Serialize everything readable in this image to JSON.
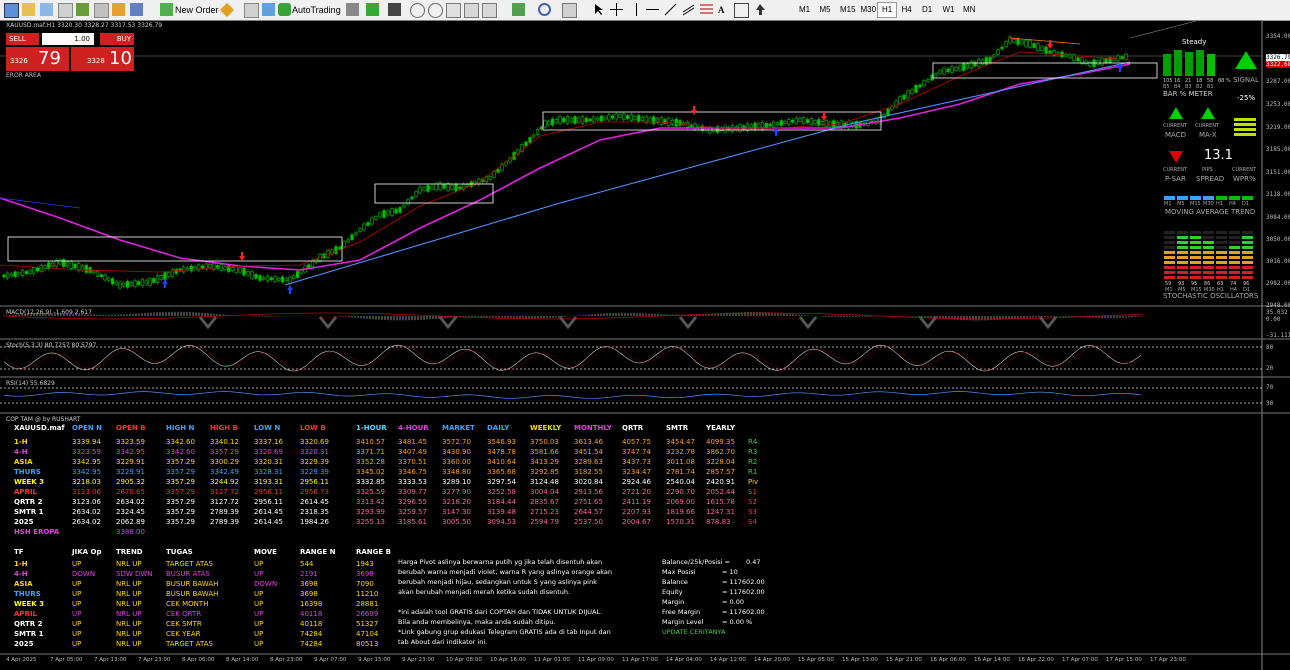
{
  "toolbar": {
    "new_order": "New Order",
    "autotrading": "AutoTrading",
    "timeframes": [
      "M1",
      "M5",
      "M15",
      "M30",
      "H1",
      "H4",
      "D1",
      "W1",
      "MN"
    ],
    "active_tf": "H1"
  },
  "chart": {
    "symbol_info": "XAUUSD.maf,H1  3320.30 3328.27 3317.53 3326.79",
    "zone_label": "EROR AREA",
    "one_click": {
      "sell_label": "SELL",
      "buy_label": "BUY",
      "lot": "1.00",
      "sell_big": "79",
      "sell_small": "3326",
      "buy_big": "10",
      "buy_small": "3328"
    },
    "price_scale": [
      "3354.00",
      "3326.79",
      "3322.68",
      "3287.00",
      "3253.00",
      "3219.00",
      "3185.00",
      "3151.00",
      "3118.00",
      "3084.00",
      "3050.00",
      "3016.00",
      "2982.00",
      "2948.00"
    ],
    "time_axis": [
      "4 Apr 2025",
      "7 Apr 05:00",
      "7 Apr 13:00",
      "7 Apr 23:00",
      "8 Apr 06:00",
      "8 Apr 14:00",
      "8 Apr 23:00",
      "9 Apr 07:00",
      "9 Apr 15:00",
      "9 Apr 23:00",
      "10 Apr 08:00",
      "10 Apr 16:00",
      "11 Apr 01:00",
      "11 Apr 09:00",
      "11 Apr 17:00",
      "14 Apr 04:00",
      "14 Apr 12:00",
      "14 Apr 20:00",
      "15 Apr 05:00",
      "15 Apr 13:00",
      "15 Apr 21:00",
      "16 Apr 06:00",
      "16 Apr 14:00",
      "16 Apr 22:00",
      "17 Apr 07:00",
      "17 Apr 15:00",
      "17 Apr 23:00"
    ],
    "colors": {
      "bull": "#00c000",
      "bear": "#00c000",
      "ma_fast": "#c00000",
      "ma_slow": "#e020e0",
      "trend": "#5090ff",
      "bg": "#000000"
    }
  },
  "indicators": {
    "macd_label": "MACD(12,26,9) -1.609 2.617",
    "macd_scale": [
      "35.032",
      "0.00",
      "-31.111"
    ],
    "stoch_label": "Stoch(5,3,3) 80.7257 80.5797",
    "stoch_scale": [
      "80",
      "20"
    ],
    "rsi_label": "RSI(14) 55.6829",
    "rsi_scale": [
      "70",
      "30"
    ],
    "cop_label": "COP TAM @ by RUSHART"
  },
  "dashboard": {
    "steady": "Steady",
    "bar_meter_values": [
      "105",
      "16",
      "21",
      "18",
      "58",
      "88 %"
    ],
    "bar_meter_tfs": [
      "B5",
      "B4",
      "B3",
      "B2",
      "B1"
    ],
    "bar_meter_label": "BAR % METER",
    "signal_label": "SIGNAL",
    "signal_pct": "-25%",
    "macd": "MACD",
    "max": "MA-X",
    "current": "CURRENT",
    "psar": "P-SAR",
    "spread": "SPREAD",
    "spread_value": "13.1",
    "pips": "PIPS",
    "wpr": "WPR%",
    "ma_trend_tfs": [
      "M1",
      "M5",
      "M15",
      "M30",
      "H1",
      "H4",
      "D1"
    ],
    "ma_trend_label": "MOVING AVERAGE TREND",
    "stoch_values": [
      "59",
      "93",
      "95",
      "86",
      "63",
      "74",
      "96"
    ],
    "stoch_tfs": [
      "M1",
      "M5",
      "M15",
      "M30",
      "H1",
      "H4",
      "D1"
    ],
    "stoch_label": "STOCHASTIC OSCILLATORS"
  },
  "table1": {
    "headers": [
      "XAUUSD.maf",
      "OPEN N",
      "OPEN B",
      "HIGH N",
      "HIGH B",
      "LOW N",
      "LOW B",
      "1-HOUR",
      "4-HOUR",
      "MARKET",
      "DAILY",
      "WEEKLY",
      "MONTHLY",
      "QRTR",
      "SMTR",
      "YEARLY",
      ""
    ],
    "rows": [
      {
        "name": "1-H",
        "c": "#ffd700",
        "cells": [
          "3339.94",
          "3323.59",
          "3342.60",
          "3340.12",
          "3337.16",
          "3320.69",
          "3410.57",
          "3481.45",
          "3572.70",
          "3546.93",
          "3750.03",
          "3613.46",
          "4057.75",
          "3454.47",
          "4099.35",
          "R4"
        ]
      },
      {
        "name": "4-H",
        "c": "#e040e0",
        "cells": [
          "3323.59",
          "3342.95",
          "3342.60",
          "3357.29",
          "3320.69",
          "3320.31",
          "3371.71",
          "3407.49",
          "3430.90",
          "3478.78",
          "3581.66",
          "3451.54",
          "3747.74",
          "3232.78",
          "3862.70",
          "R3"
        ]
      },
      {
        "name": "ASIA",
        "c": "#ffd700",
        "cells": [
          "3342.95",
          "3229.91",
          "3357.29",
          "3300.29",
          "3320.31",
          "3229.39",
          "3352.28",
          "3370.51",
          "3360.00",
          "3410.64",
          "3413.29",
          "3289.63",
          "3437.73",
          "3011.08",
          "3228.04",
          "R2"
        ]
      },
      {
        "name": "THURS",
        "c": "#40a0ff",
        "cells": [
          "3342.95",
          "3229.91",
          "3357.29",
          "3342.49",
          "3328.31",
          "3229.39",
          "3345.02",
          "3346.75",
          "3348.80",
          "3365.68",
          "3292.85",
          "3182.55",
          "3234.47",
          "2781.74",
          "2857.57",
          "R1"
        ]
      },
      {
        "name": "WEEK 3",
        "c": "#ffff00",
        "cells": [
          "3218.03",
          "2905.32",
          "3357.29",
          "3244.92",
          "3193.31",
          "2956.11",
          "3332.85",
          "3333.53",
          "3289.10",
          "3297.54",
          "3124.48",
          "3020.84",
          "2924.46",
          "2540.04",
          "2420.91",
          "Piv"
        ]
      },
      {
        "name": "APRIL",
        "c": "#ff3030",
        "cells": [
          "3123.06",
          "2670.65",
          "3357.29",
          "3127.72",
          "2956.11",
          "2956.73",
          "3325.59",
          "3309.77",
          "3277.90",
          "3252.58",
          "3004.04",
          "2913.56",
          "2721.20",
          "2290.70",
          "2052.44",
          "S1"
        ]
      },
      {
        "name": "QRTR 2",
        "c": "#ffffff",
        "cells": [
          "3123.06",
          "2634.02",
          "3357.29",
          "3127.72",
          "2956.11",
          "2614.45",
          "3313.42",
          "3296.55",
          "3218.20",
          "3184.44",
          "2835.67",
          "2751.65",
          "2411.19",
          "2069.00",
          "1615.78",
          "S2"
        ]
      },
      {
        "name": "SMTR 1",
        "c": "#ffffff",
        "cells": [
          "2634.02",
          "2324.45",
          "3357.29",
          "2789.39",
          "2614.45",
          "2318.35",
          "3293.99",
          "3259.57",
          "3147.30",
          "3139.48",
          "2715.23",
          "2644.57",
          "2207.93",
          "1819.66",
          "1247.31",
          "S3"
        ]
      },
      {
        "name": "2025",
        "c": "#ffffff",
        "cells": [
          "2634.02",
          "2062.89",
          "3357.29",
          "2789.39",
          "2614.45",
          "1984.26",
          "3255.13",
          "3185.61",
          "3005.50",
          "3094.53",
          "2594.79",
          "2537.50",
          "2004.67",
          "1570.31",
          "878.83",
          "S4"
        ]
      },
      {
        "name": "HSH EROPA",
        "c": "#e040e0",
        "cells": [
          "",
          "3388.00",
          "",
          "",
          "",
          "",
          "",
          "",
          "",
          "",
          "",
          "",
          "",
          "",
          "",
          ""
        ]
      }
    ]
  },
  "table2": {
    "headers": [
      "TF",
      "JIKA Op",
      "TREND",
      "TUGAS",
      "MOVE",
      "RANGE N",
      "RANGE B"
    ],
    "rows": [
      {
        "c": "#ffd700",
        "cells": [
          "1-H",
          "UP",
          "NRL UP",
          "TARGET ATAS",
          "UP",
          "544",
          "1943"
        ]
      },
      {
        "c": "#e040e0",
        "cells": [
          "4-H",
          "DOWN",
          "SDW DWN",
          "BUSUR ATAS",
          "UP",
          "2191",
          "3698"
        ]
      },
      {
        "c": "#ffd700",
        "cells": [
          "ASIA",
          "UP",
          "NRL UP",
          "BUSUR BAWAH",
          "DOWN",
          "3698",
          "7090"
        ]
      },
      {
        "c": "#40a0ff",
        "cells": [
          "THURS",
          "UP",
          "NRL UP",
          "BUSUR BAWAH",
          "UP",
          "3698",
          "11210"
        ]
      },
      {
        "c": "#ffff00",
        "cells": [
          "WEEK 3",
          "UP",
          "NRL UP",
          "CEK MONTH",
          "UP",
          "16398",
          "28881"
        ]
      },
      {
        "c": "#ff3030",
        "cells": [
          "APRIL",
          "UP",
          "NRL UP",
          "CEK QRTR",
          "UP",
          "40118",
          "26699"
        ]
      },
      {
        "c": "#ffffff",
        "cells": [
          "QRTR 2",
          "UP",
          "NRL UP",
          "CEK SMTR",
          "UP",
          "40118",
          "51327"
        ]
      },
      {
        "c": "#ffffff",
        "cells": [
          "SMTR 1",
          "UP",
          "NRL UP",
          "CEK YEAR",
          "UP",
          "74284",
          "47104"
        ]
      },
      {
        "c": "#ffffff",
        "cells": [
          "2025",
          "UP",
          "NRL UP",
          "TARGET ATAS",
          "UP",
          "74284",
          "80513"
        ]
      }
    ]
  },
  "notes": [
    "Harga Pivot aslinya berwarna putih yg jika telah disentuh akan",
    "berubah warna menjadi violet, warna R yang aslinya orange akan",
    "berubah menjadi hijau, sedangkan untuk S yang aslinya pink",
    "akan berubah menjadi merah ketika sudah disentuh.",
    "",
    "*ini adalah tool GRATIS dari COPTAH dan TIDAK UNTUK DIJUAL.",
    "  Bila anda membelinya, maka anda sudah ditipu.",
    "*Link gabung grup edukasi Telegram GRATIS ada di tab Input dan",
    "  tab About dari indikator ini."
  ],
  "account": {
    "rows": [
      [
        "Balance/25k/Posisi =",
        "0.47"
      ],
      [
        "Max Posisi",
        "=  10"
      ],
      [
        "Balance",
        "=  117602.00"
      ],
      [
        "Equity",
        "=  117602.00"
      ],
      [
        "Margin",
        "=  0.00"
      ],
      [
        "Free Margin",
        "=  117602.00"
      ],
      [
        "Margin Level",
        "=  0.00 %"
      ]
    ],
    "update": "UPDATE CERITANYA"
  }
}
